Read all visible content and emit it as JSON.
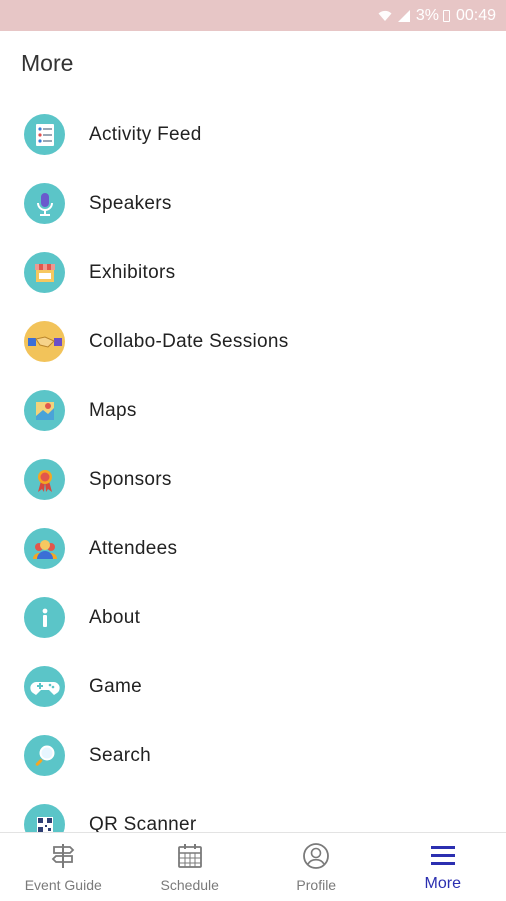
{
  "status_bar": {
    "battery": "3%",
    "time": "00:49",
    "icons": [
      "wifi-icon",
      "signal-icon",
      "battery-icon"
    ]
  },
  "page": {
    "title": "More"
  },
  "menu": {
    "items": [
      {
        "label": "Activity Feed",
        "icon": "activity-feed-icon"
      },
      {
        "label": "Speakers",
        "icon": "microphone-icon"
      },
      {
        "label": "Exhibitors",
        "icon": "booth-icon"
      },
      {
        "label": "Collabo-Date Sessions",
        "icon": "handshake-icon"
      },
      {
        "label": "Maps",
        "icon": "map-icon"
      },
      {
        "label": "Sponsors",
        "icon": "ribbon-icon"
      },
      {
        "label": "Attendees",
        "icon": "attendees-icon"
      },
      {
        "label": "About",
        "icon": "info-icon"
      },
      {
        "label": "Game",
        "icon": "gamepad-icon"
      },
      {
        "label": "Search",
        "icon": "magnifier-icon"
      },
      {
        "label": "QR Scanner",
        "icon": "qr-code-icon"
      }
    ]
  },
  "bottom_nav": {
    "tabs": [
      {
        "label": "Event Guide",
        "icon": "signpost-icon",
        "active": false
      },
      {
        "label": "Schedule",
        "icon": "calendar-icon",
        "active": false
      },
      {
        "label": "Profile",
        "icon": "profile-icon",
        "active": false
      },
      {
        "label": "More",
        "icon": "hamburger-menu-icon",
        "active": true
      }
    ]
  },
  "colors": {
    "status_bar": "#e7c6c6",
    "icon_circle": "#5bc5c8",
    "active_tab": "#2b2fb0",
    "inactive_tab": "#7a7a7a"
  }
}
